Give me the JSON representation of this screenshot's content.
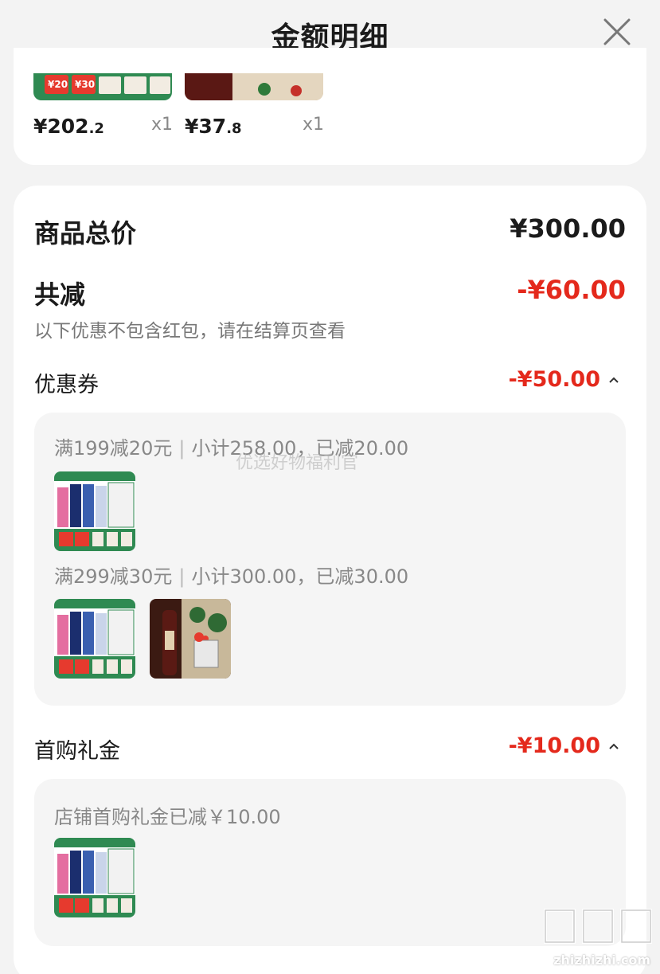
{
  "header": {
    "title": "金额明细"
  },
  "products": [
    {
      "price_int": "¥202",
      "price_dec": ".2",
      "qty": "x1"
    },
    {
      "price_int": "¥37",
      "price_dec": ".8",
      "qty": "x1"
    }
  ],
  "summary": {
    "total_label": "商品总价",
    "total_value": "¥300.00",
    "reduce_label": "共减",
    "reduce_value": "-¥60.00",
    "note": "以下优惠不包含红包，请在结算页查看"
  },
  "coupon": {
    "label": "优惠券",
    "value": "-¥50.00",
    "lines": [
      {
        "rule": "满199减20元",
        "detail": "小计258.00，已减20.00"
      },
      {
        "rule": "满299减30元",
        "detail": "小计300.00，已减30.00"
      }
    ]
  },
  "first_gift": {
    "label": "首购礼金",
    "value": "-¥10.00",
    "line": "店铺首购礼金已减￥10.00"
  },
  "watermark": "优选好物福利官",
  "site": {
    "url": "zhizhizhi.com"
  },
  "colors": {
    "accent_red": "#e4291c",
    "muted_text": "#888888"
  },
  "icons": [
    "close-icon",
    "chevron-up-icon"
  ]
}
